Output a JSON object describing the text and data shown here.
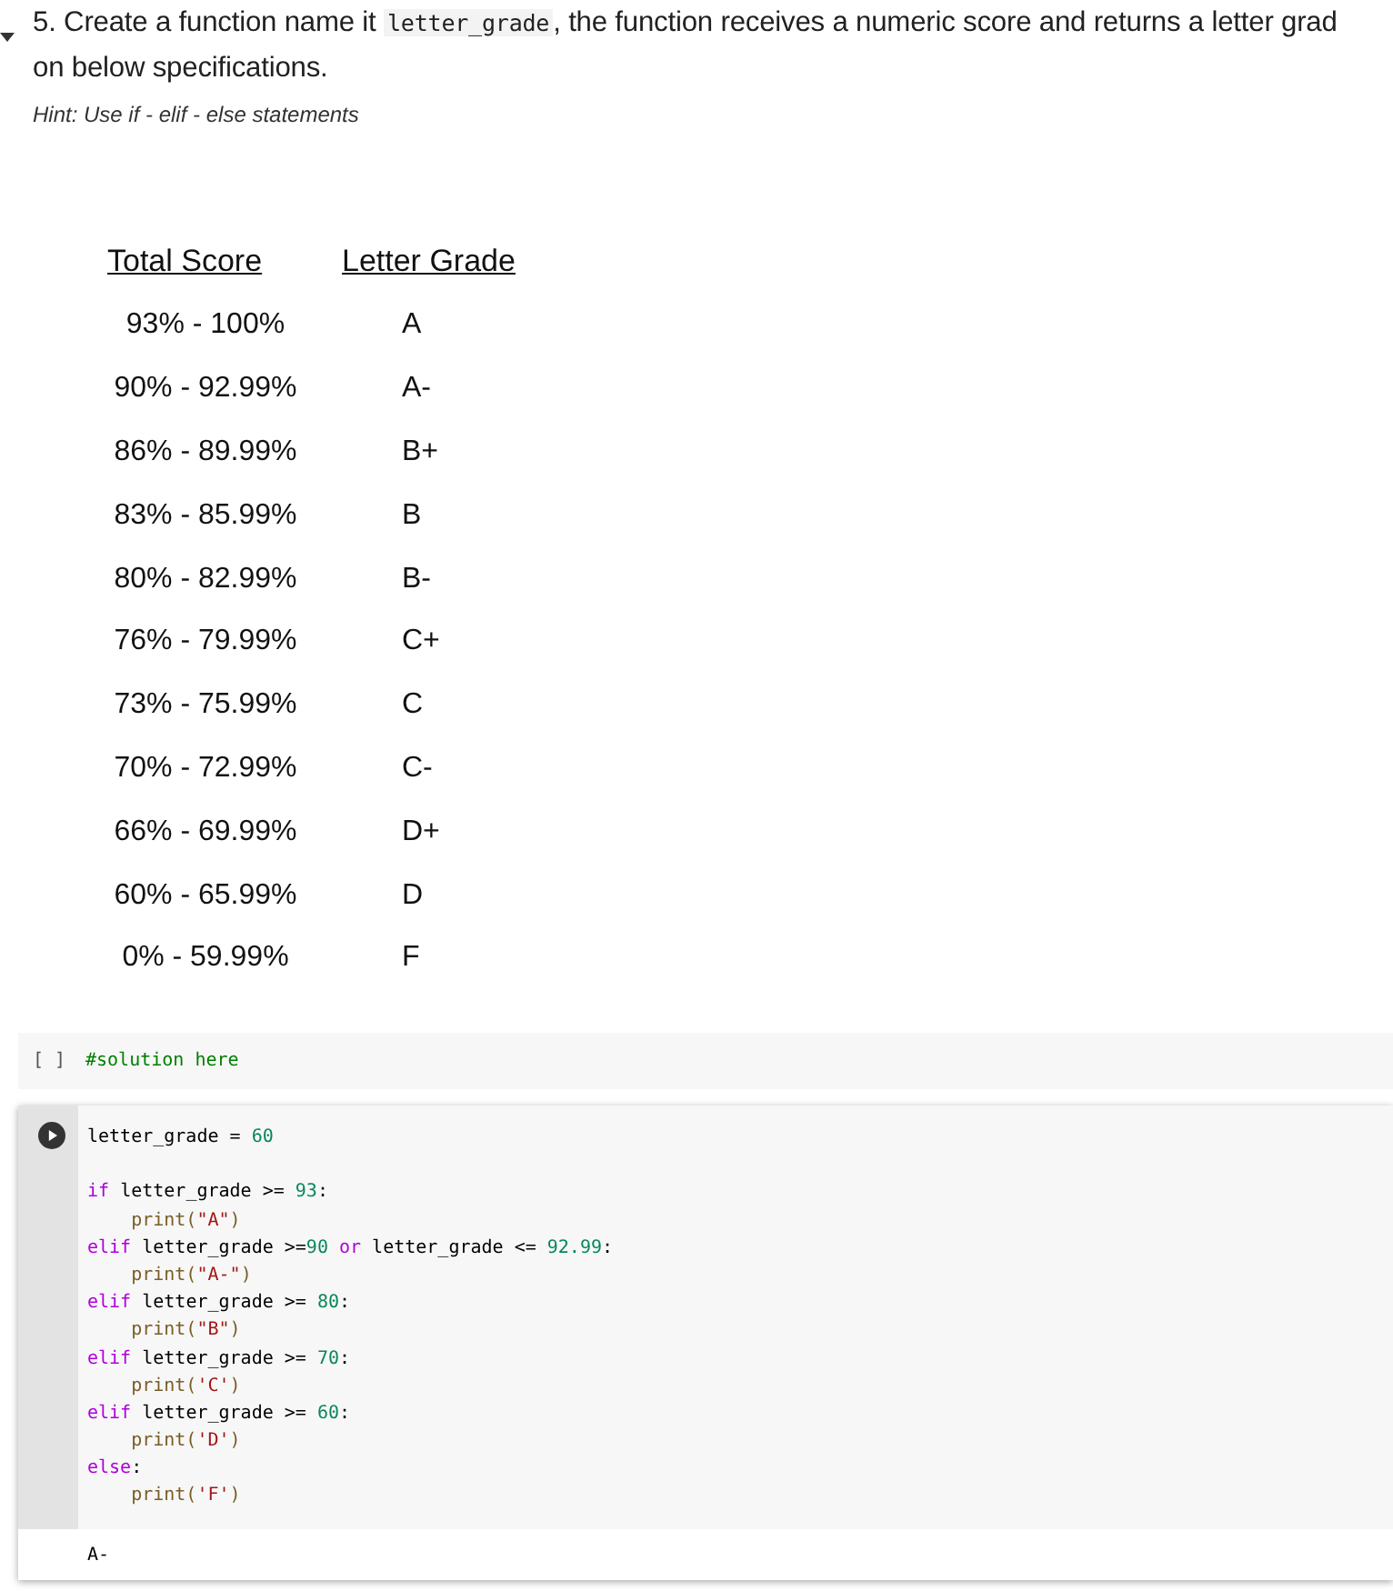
{
  "question": {
    "line_1_before": "5. Create a function name it ",
    "line_1_code": "letter_grade",
    "line_1_after": ", the function receives a numeric score and returns a letter grad",
    "line_2": "on below specifications.",
    "hint": "Hint: Use if - elif - else statements",
    "expanded": true
  },
  "grade_table": {
    "columns": [
      "Total Score",
      "Letter Grade"
    ],
    "rows": [
      [
        "93% - 100%",
        "A"
      ],
      [
        "90% - 92.99%",
        "A-"
      ],
      [
        "86% - 89.99%",
        "B+"
      ],
      [
        "83% - 85.99%",
        "B"
      ],
      [
        "80% - 82.99%",
        "B-"
      ],
      [
        "76% - 79.99%",
        "C+"
      ],
      [
        "73% - 75.99%",
        "C"
      ],
      [
        "70% - 72.99%",
        "C-"
      ],
      [
        "66% - 69.99%",
        "D+"
      ],
      [
        "60% - 65.99%",
        "D"
      ],
      [
        "0% - 59.99%",
        "F"
      ]
    ]
  },
  "cells": [
    {
      "kind": "idle",
      "prompt": "[ ]",
      "lines": [
        {
          "tokens": [
            {
              "kind": "comment",
              "text": "#solution here"
            }
          ]
        }
      ]
    },
    {
      "kind": "focused",
      "lines": [
        {
          "tokens": [
            {
              "kind": "name",
              "text": "letter_grade = "
            },
            {
              "kind": "num",
              "text": "60"
            }
          ]
        },
        {
          "gap_before": true,
          "tokens": [
            {
              "kind": "kw",
              "text": "if"
            },
            {
              "kind": "name",
              "text": " letter_grade >= "
            },
            {
              "kind": "num",
              "text": "93"
            },
            {
              "kind": "name",
              "text": ":"
            }
          ]
        },
        {
          "tokens": [
            {
              "kind": "fn",
              "text": "    print("
            },
            {
              "kind": "str",
              "text": "\"A\""
            },
            {
              "kind": "fn",
              "text": ")"
            }
          ]
        },
        {
          "tokens": [
            {
              "kind": "kw",
              "text": "elif"
            },
            {
              "kind": "name",
              "text": " letter_grade >="
            },
            {
              "kind": "num",
              "text": "90"
            },
            {
              "kind": "kw",
              "text": " or"
            },
            {
              "kind": "name",
              "text": " letter_grade <= "
            },
            {
              "kind": "num",
              "text": "92.99"
            },
            {
              "kind": "name",
              "text": ":"
            }
          ]
        },
        {
          "tokens": [
            {
              "kind": "fn",
              "text": "    print("
            },
            {
              "kind": "str",
              "text": "\"A-\""
            },
            {
              "kind": "fn",
              "text": ")"
            }
          ]
        },
        {
          "tokens": [
            {
              "kind": "kw",
              "text": "elif"
            },
            {
              "kind": "name",
              "text": " letter_grade >= "
            },
            {
              "kind": "num",
              "text": "80"
            },
            {
              "kind": "name",
              "text": ":"
            }
          ]
        },
        {
          "tokens": [
            {
              "kind": "fn",
              "text": "    print("
            },
            {
              "kind": "str",
              "text": "\"B\""
            },
            {
              "kind": "fn",
              "text": ")"
            }
          ]
        },
        {
          "tokens": [
            {
              "kind": "kw",
              "text": "elif"
            },
            {
              "kind": "name",
              "text": " letter_grade >= "
            },
            {
              "kind": "num",
              "text": "70"
            },
            {
              "kind": "name",
              "text": ":"
            }
          ]
        },
        {
          "tokens": [
            {
              "kind": "fn",
              "text": "    print("
            },
            {
              "kind": "str",
              "text": "'C'"
            },
            {
              "kind": "fn",
              "text": ")"
            }
          ]
        },
        {
          "tokens": [
            {
              "kind": "kw",
              "text": "elif"
            },
            {
              "kind": "name",
              "text": " letter_grade >= "
            },
            {
              "kind": "num",
              "text": "60"
            },
            {
              "kind": "name",
              "text": ":"
            }
          ]
        },
        {
          "tokens": [
            {
              "kind": "fn",
              "text": "    print("
            },
            {
              "kind": "str",
              "text": "'D'"
            },
            {
              "kind": "fn",
              "text": ")"
            }
          ]
        },
        {
          "tokens": [
            {
              "kind": "kw",
              "text": "else"
            },
            {
              "kind": "name",
              "text": ":"
            }
          ]
        },
        {
          "tokens": [
            {
              "kind": "fn",
              "text": "    print("
            },
            {
              "kind": "str",
              "text": "'F'"
            },
            {
              "kind": "fn",
              "text": ")"
            }
          ]
        }
      ],
      "output": "A-"
    }
  ]
}
